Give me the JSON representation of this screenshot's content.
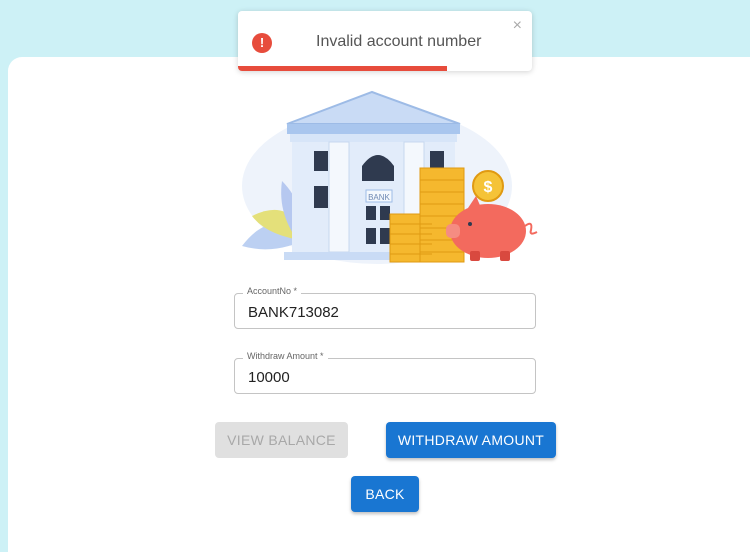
{
  "toast": {
    "message": "Invalid account number",
    "icon": "error-icon",
    "close_label": "×",
    "progress_remaining": 0.71,
    "accent_color": "#e74c3c"
  },
  "illustration": {
    "bank_sign": "BANK",
    "coin_symbol": "$"
  },
  "form": {
    "account_label": "AccountNo *",
    "account_value": "BANK713082",
    "amount_label": "Withdraw Amount *",
    "amount_value": "10000"
  },
  "buttons": {
    "view_balance": "VIEW BALANCE",
    "withdraw": "WITHDRAW AMOUNT",
    "back": "BACK"
  },
  "colors": {
    "background": "#cdf1f6",
    "primary": "#1976d2",
    "disabled": "#e0e0e0"
  }
}
